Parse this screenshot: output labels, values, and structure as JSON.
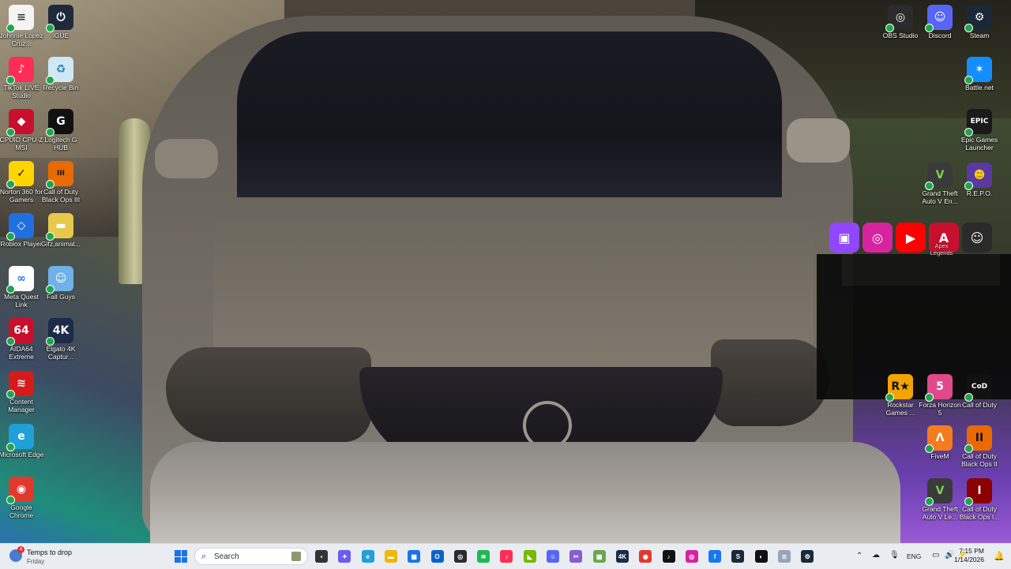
{
  "desktop": {
    "left_icons": [
      {
        "name": "johnnie-icon",
        "label": "Johnnie Lopez Cruz...",
        "color": "#f4f4f4",
        "glyph": "≡",
        "text": "#333"
      },
      {
        "name": "igue-icon",
        "label": "iGUE",
        "color": "#1e2a3a",
        "glyph": "⏻",
        "text": "#fff"
      },
      {
        "name": "tiktok-live-icon",
        "label": "TikTok LIVE Studio",
        "color": "#ff2d55",
        "glyph": "♪",
        "text": "#fff"
      },
      {
        "name": "recycle-bin-icon",
        "label": "Recycle Bin",
        "color": "#cfe8f5",
        "glyph": "♻",
        "text": "#2a7fb8"
      },
      {
        "name": "cpuz-icon",
        "label": "CPUID CPU-Z MSI",
        "color": "#c8102e",
        "glyph": "◆",
        "text": "#fff"
      },
      {
        "name": "logitech-icon",
        "label": "Logitech G HUB",
        "color": "#111111",
        "glyph": "G",
        "text": "#fff"
      },
      {
        "name": "norton-icon",
        "label": "Norton 360 for Gamers",
        "color": "#ffd400",
        "glyph": "✓",
        "text": "#111"
      },
      {
        "name": "cod-bo3-icon",
        "label": "Call of Duty Black Ops III",
        "color": "#e86a00",
        "glyph": "III",
        "text": "#111"
      },
      {
        "name": "roblox-icon",
        "label": "Roblox Player",
        "color": "#1e6fe0",
        "glyph": "◇",
        "text": "#fff"
      },
      {
        "name": "gifz-icon",
        "label": "Gifz,animat...",
        "color": "#e6c94a",
        "glyph": "▬",
        "text": "#fff"
      },
      {
        "name": "meta-quest-icon",
        "label": "Meta Quest Link",
        "color": "#ffffff",
        "glyph": "∞",
        "text": "#1877f2"
      },
      {
        "name": "fall-guys-icon",
        "label": "Fall Guys",
        "color": "#6fb1e8",
        "glyph": "☺",
        "text": "#fff"
      },
      {
        "name": "aida64-icon",
        "label": "AIDA64 Extreme",
        "color": "#c8102e",
        "glyph": "64",
        "text": "#fff"
      },
      {
        "name": "elgato-icon",
        "label": "Elgato 4K Captur...",
        "color": "#1b2b48",
        "glyph": "4K",
        "text": "#fff"
      },
      {
        "name": "content-manager-icon",
        "label": "Content Manager",
        "color": "#d41c1c",
        "glyph": "≋",
        "text": "#fff"
      },
      {
        "name": "edge-icon",
        "label": "Microsoft Edge",
        "color": "#1fa0d8",
        "glyph": "e",
        "text": "#fff"
      },
      {
        "name": "chrome-icon",
        "label": "Google Chrome",
        "color": "#e0392b",
        "glyph": "◉",
        "text": "#fff"
      }
    ],
    "right_icons": [
      {
        "name": "obs-icon",
        "label": "OBS Studio",
        "color": "#2b2b2b",
        "glyph": "◎",
        "text": "#fff"
      },
      {
        "name": "discord-icon",
        "label": "Discord",
        "color": "#5865f2",
        "glyph": "☺",
        "text": "#fff"
      },
      {
        "name": "steam-icon",
        "label": "Steam",
        "color": "#1b2838",
        "glyph": "⚙",
        "text": "#fff"
      },
      {
        "name": "battlenet-icon",
        "label": "Battle.net",
        "color": "#148eff",
        "glyph": "✶",
        "text": "#fff"
      },
      {
        "name": "epic-icon",
        "label": "Epic Games Launcher",
        "color": "#1a1a1a",
        "glyph": "EPIC",
        "text": "#fff"
      },
      {
        "name": "gta5-icon",
        "label": "Grand Theft Auto V En...",
        "color": "#3a3a3a",
        "glyph": "V",
        "text": "#7ad34a"
      },
      {
        "name": "repo-icon",
        "label": "R.E.P.O.",
        "color": "#5a3aa0",
        "glyph": "☻",
        "text": "#ffd000"
      },
      {
        "name": "rockstar-icon",
        "label": "Rockstar Games ...",
        "color": "#f2a400",
        "glyph": "R★",
        "text": "#111"
      },
      {
        "name": "forza-icon",
        "label": "Forza Horizon 5",
        "color": "#e04a8a",
        "glyph": "5",
        "text": "#fff"
      },
      {
        "name": "cod-icon",
        "label": "Call of Duty",
        "color": "#111111",
        "glyph": "CoD",
        "text": "#fff"
      },
      {
        "name": "fivem-icon",
        "label": "FiveM",
        "color": "#f47b20",
        "glyph": "Λ",
        "text": "#fff"
      },
      {
        "name": "cod-bo2-icon",
        "label": "Call of Duty Black Ops II",
        "color": "#e86a00",
        "glyph": "II",
        "text": "#111"
      },
      {
        "name": "gta5-legacy-icon",
        "label": "Grand Theft Auto V Le...",
        "color": "#3a3a3a",
        "glyph": "V",
        "text": "#7ad34a"
      },
      {
        "name": "cod-bo-icon",
        "label": "Call of Duty Black Ops I...",
        "color": "#8b0000",
        "glyph": "I",
        "text": "#fff"
      }
    ],
    "apex_label": "Apex Legends",
    "social": [
      {
        "name": "twitch-icon",
        "color": "#9146ff",
        "glyph": "▣"
      },
      {
        "name": "instagram-icon",
        "color": "#d6249f",
        "glyph": "◎"
      },
      {
        "name": "youtube-icon",
        "color": "#ff0000",
        "glyph": "▶"
      },
      {
        "name": "apex-icon",
        "color": "#c8102e",
        "glyph": "A"
      },
      {
        "name": "kick-icon",
        "color": "#2a2a2a",
        "glyph": "☺"
      }
    ]
  },
  "taskbar": {
    "weather_line1": "Temps to drop",
    "weather_line2": "Friday",
    "weather_badge": "4",
    "search_placeholder": "Search",
    "apps": [
      {
        "name": "file-explorer-mini-icon",
        "color": "#333333",
        "glyph": "▪"
      },
      {
        "name": "copilot-icon",
        "color": "#6a5cf0",
        "glyph": "✦"
      },
      {
        "name": "edge-taskbar-icon",
        "color": "#1fa0d8",
        "glyph": "e"
      },
      {
        "name": "file-explorer-icon",
        "color": "#f2b705",
        "glyph": "▬"
      },
      {
        "name": "store-icon",
        "color": "#1a73e8",
        "glyph": "▦"
      },
      {
        "name": "outlook-icon",
        "color": "#0a64c8",
        "glyph": "O"
      },
      {
        "name": "obs-taskbar-icon",
        "color": "#2b2b2b",
        "glyph": "◎"
      },
      {
        "name": "spotify-icon",
        "color": "#1db954",
        "glyph": "≋"
      },
      {
        "name": "tiktok-taskbar-icon",
        "color": "#ff2d55",
        "glyph": "♪"
      },
      {
        "name": "nvidia-icon",
        "color": "#76b900",
        "glyph": "◣"
      },
      {
        "name": "discord-taskbar-icon",
        "color": "#5865f2",
        "glyph": "☺"
      },
      {
        "name": "snip-icon",
        "color": "#8a5cd0",
        "glyph": "✂"
      },
      {
        "name": "minecraft-icon",
        "color": "#6aa84f",
        "glyph": "▦"
      },
      {
        "name": "elgato-taskbar-icon",
        "color": "#1b2b48",
        "glyph": "4K"
      },
      {
        "name": "chrome-taskbar-icon",
        "color": "#e0392b",
        "glyph": "◉"
      },
      {
        "name": "tiktok-live-taskbar-icon",
        "color": "#111111",
        "glyph": "♪"
      },
      {
        "name": "instagram-taskbar-icon",
        "color": "#d6249f",
        "glyph": "◎"
      },
      {
        "name": "facebook-icon",
        "color": "#1877f2",
        "glyph": "f"
      },
      {
        "name": "steam-taskbar-icon",
        "color": "#1b2838",
        "glyph": "S"
      },
      {
        "name": "github-icon",
        "color": "#111111",
        "glyph": "◐"
      },
      {
        "name": "notepad-icon",
        "color": "#9aa4b8",
        "glyph": "≣"
      },
      {
        "name": "steam-running-icon",
        "color": "#1b2838",
        "glyph": "⚙"
      }
    ],
    "tray_language": "ENG",
    "time": "7:15 PM",
    "date": "1/14/2026"
  }
}
